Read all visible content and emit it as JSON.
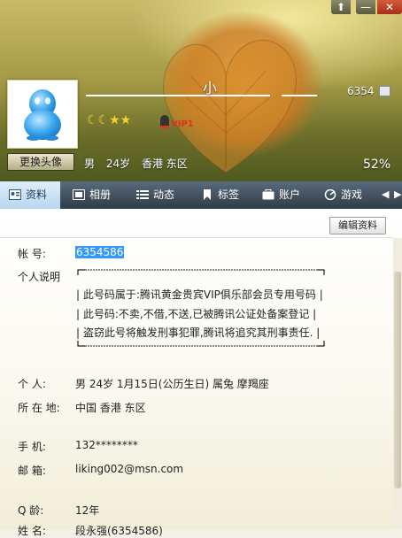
{
  "window": {
    "skin_icon": "shirt-icon",
    "minimize_glyph": "—",
    "close_glyph": "✕"
  },
  "header": {
    "nickname": "小",
    "qq_short": "6354",
    "change_avatar_label": "更换头像",
    "vip_label": "VIP1",
    "levels": "☾☾★★",
    "gender": "男",
    "age": "24岁",
    "location": "香港 东区",
    "completion": "52%"
  },
  "tabs": [
    {
      "label": "资料",
      "icon": "profile-card-icon"
    },
    {
      "label": "相册",
      "icon": "photo-album-icon"
    },
    {
      "label": "动态",
      "icon": "feed-icon"
    },
    {
      "label": "标签",
      "icon": "bookmark-icon"
    },
    {
      "label": "账户",
      "icon": "wallet-icon"
    },
    {
      "label": "游戏",
      "icon": "game-icon"
    }
  ],
  "toolbar": {
    "edit_label": "编辑资料"
  },
  "profile": {
    "account_label": "帐    号:",
    "account_value": "6354586",
    "sign_label": "个人说明",
    "sign_lines": [
      "| 此号码属于:腾讯黄金贵宾VIP俱乐部会员专用号码 |",
      "| 此号码:不卖,不借,不送,已被腾讯公证处备案登记   |",
      "| 盗窃此号将触发刑事犯罪,腾讯将追究其刑事责任.  |"
    ],
    "personal_label": "个    人:",
    "personal_value": "男    24岁    1月15日(公历生日)    属兔    摩羯座",
    "location_label": "所 在 地:",
    "location_value": "中国 香港 东区",
    "mobile_label": "手    机:",
    "mobile_value": "132********",
    "email_label": "邮    箱:",
    "email_value": "liking002@msn.com",
    "qage_label": "Q     龄:",
    "qage_value": "12年",
    "name_label": "姓     名:",
    "name_value": "段永强(6354586)"
  }
}
